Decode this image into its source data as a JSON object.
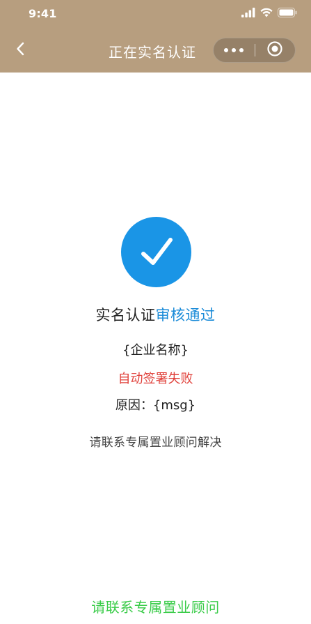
{
  "status_bar": {
    "time": "9:41",
    "icons": [
      "signal-icon",
      "wifi-icon",
      "battery-icon"
    ]
  },
  "nav": {
    "title": "正在实名认证",
    "back_icon": "chevron-left-icon",
    "more_icon": "more-dots-icon",
    "close_icon": "target-close-icon",
    "bar_color": "#b79e7f"
  },
  "result": {
    "icon": "check-circle-icon",
    "icon_color": "#1a95e6",
    "headline_prefix": "实名认证",
    "headline_status": "审核通过",
    "headline_status_color": "#1a8bd8",
    "company": "{企业名称}",
    "fail_text": "自动签署失败",
    "fail_color": "#e0403a",
    "reason": "原因：{msg}",
    "hint": "请联系专属置业顾问解决"
  },
  "footer": {
    "contact_label": "请联系专属置业顾问",
    "contact_color": "#3bcc4a"
  }
}
